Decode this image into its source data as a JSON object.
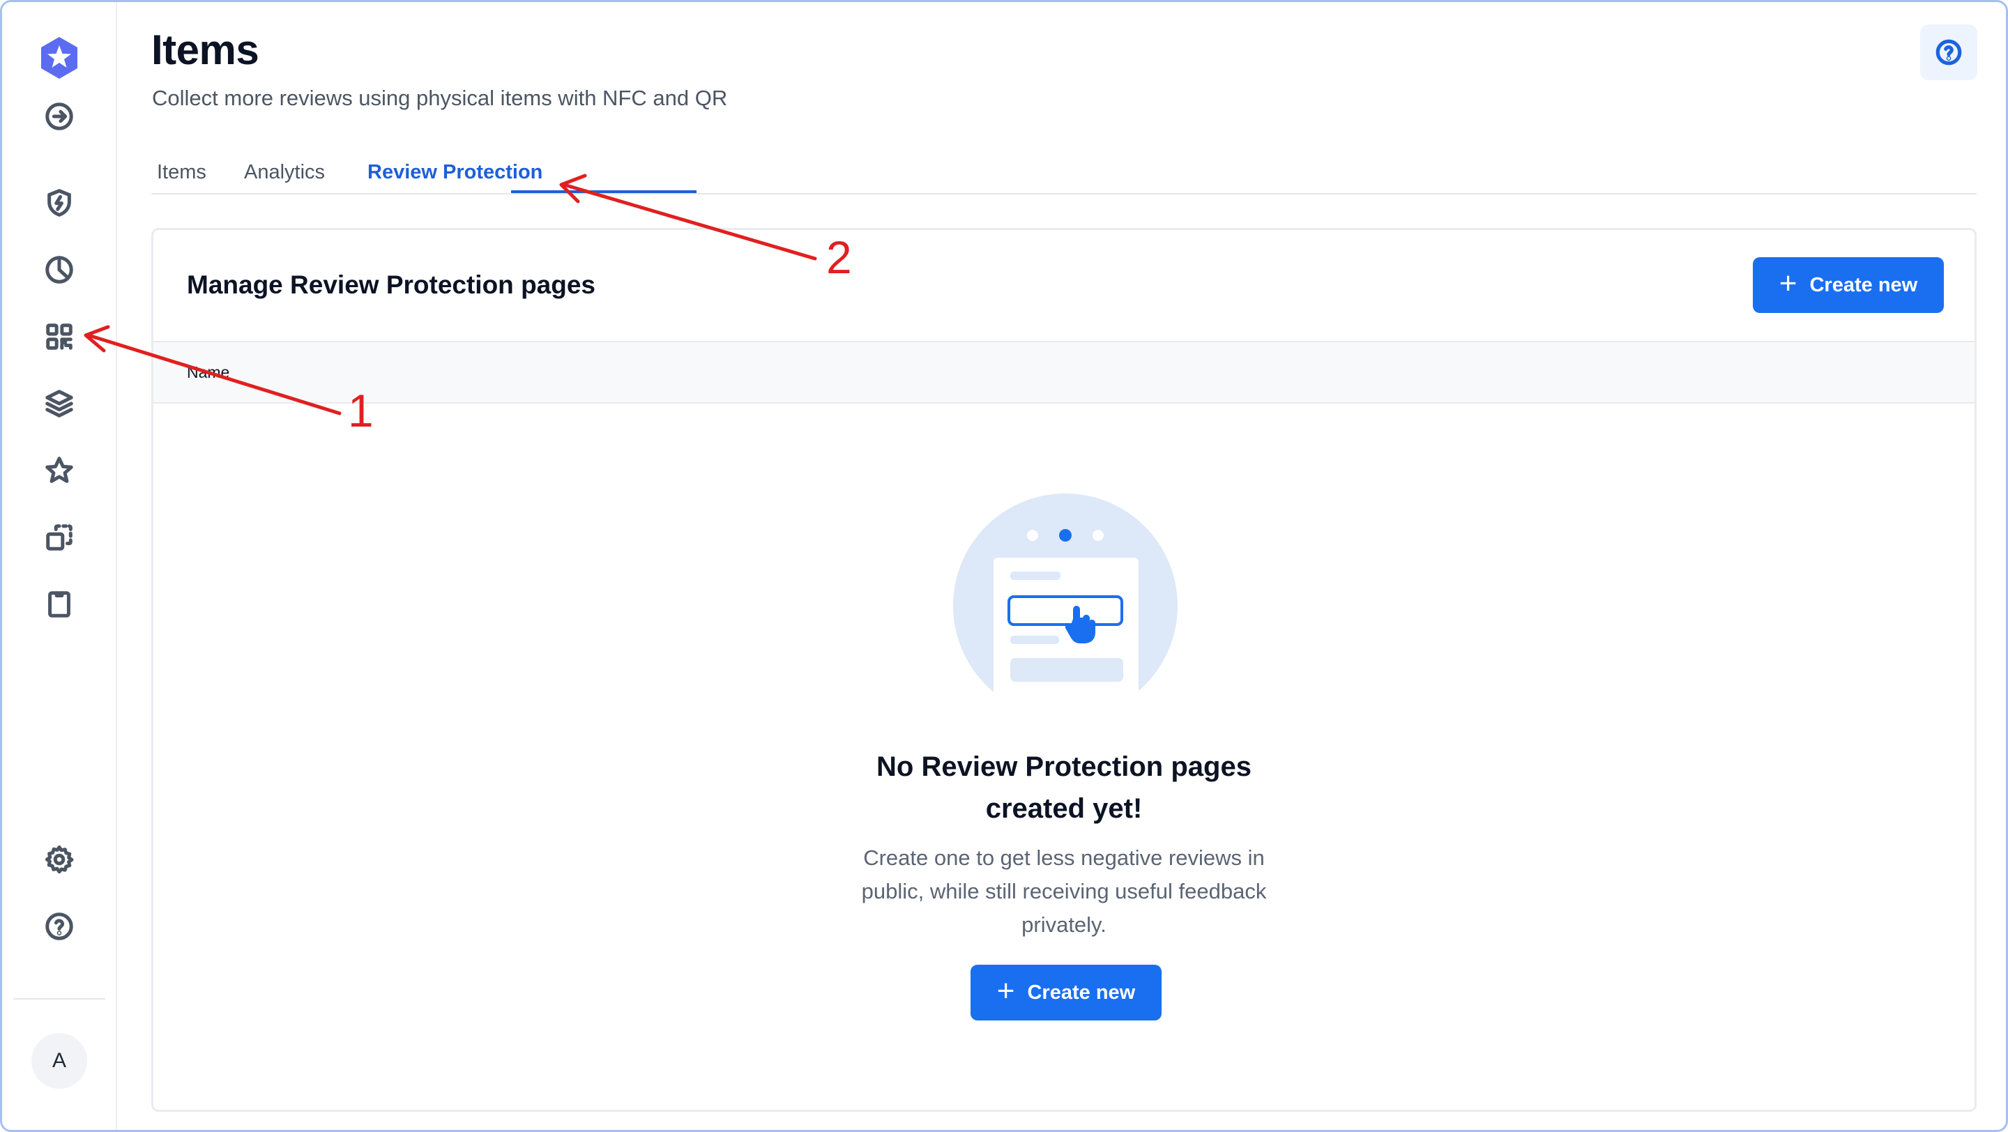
{
  "header": {
    "title": "Items",
    "subtitle": "Collect more reviews using physical items with NFC and QR"
  },
  "sidebar": {
    "items": [
      {
        "icon": "star-hex-logo-icon"
      },
      {
        "icon": "arrow-right-circle-icon"
      },
      {
        "icon": "shield-bolt-icon"
      },
      {
        "icon": "pie-chart-icon"
      },
      {
        "icon": "qr-code-icon"
      },
      {
        "icon": "layers-icon"
      },
      {
        "icon": "star-icon"
      },
      {
        "icon": "copy-dashed-icon"
      },
      {
        "icon": "clipboard-icon"
      },
      {
        "icon": "gear-icon"
      },
      {
        "icon": "help-circle-icon"
      }
    ],
    "avatar_initial": "A"
  },
  "tabs": [
    {
      "label": "Items",
      "active": false
    },
    {
      "label": "Analytics",
      "active": false
    },
    {
      "label": "Review Protection",
      "active": true
    }
  ],
  "card": {
    "title": "Manage Review Protection pages",
    "create_button_label": "Create new",
    "columns": [
      "Name"
    ],
    "empty_state": {
      "title": "No Review Protection pages created yet!",
      "description": "Create one to get less negative reviews in public, while still receiving useful feedback privately.",
      "button_label": "Create new"
    }
  },
  "annotations": [
    {
      "number": "1",
      "points_to": "qr-code-icon"
    },
    {
      "number": "2",
      "points_to": "tab-review-protection"
    }
  ],
  "colors": {
    "primary": "#1a6ff0",
    "active_tab": "#1d5fd6",
    "annotation": "#e02020",
    "frame_border": "#a7bff0",
    "logo": "#5b6cf0"
  }
}
